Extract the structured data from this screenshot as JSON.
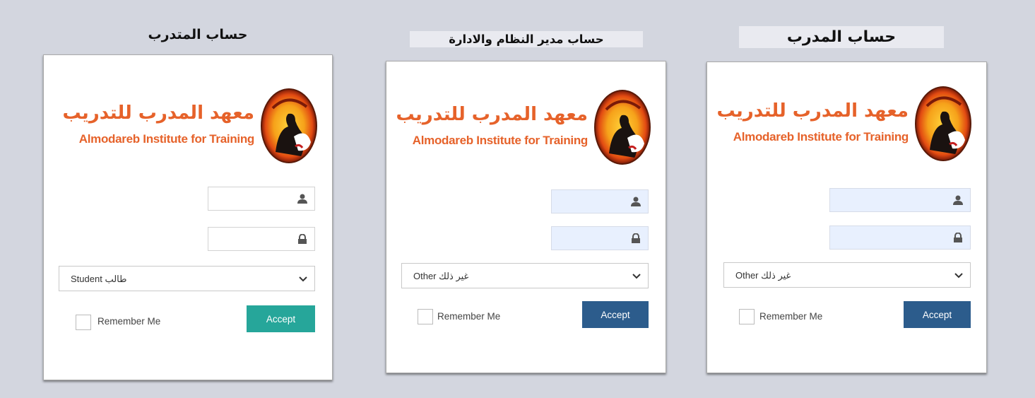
{
  "panels": [
    {
      "title": "حساب المتدرب",
      "logo": {
        "arabic": "معهد المدرب للتدريب",
        "english": "Almodareb Institute for Training"
      },
      "role_select": {
        "value": "Student طالب"
      },
      "remember_label": "Remember Me",
      "accept_label": "Accept",
      "accept_color": "#26a69a"
    },
    {
      "title": "حساب مدير النظام والادارة",
      "logo": {
        "arabic": "معهد المدرب للتدريب",
        "english": "Almodareb Institute for Training"
      },
      "role_select": {
        "value": "Other غير ذلك"
      },
      "remember_label": "Remember Me",
      "accept_label": "Accept",
      "accept_color": "#2c5c8c"
    },
    {
      "title": "حساب المدرب",
      "logo": {
        "arabic": "معهد المدرب للتدريب",
        "english": "Almodareb Institute for Training"
      },
      "role_select": {
        "value": "Other غير ذلك"
      },
      "remember_label": "Remember Me",
      "accept_label": "Accept",
      "accept_color": "#2c5c8c"
    }
  ],
  "icons": {
    "username": "user-icon",
    "password": "lock-icon",
    "dropdown": "chevron-down-icon",
    "seal": "institute-seal-logo"
  }
}
